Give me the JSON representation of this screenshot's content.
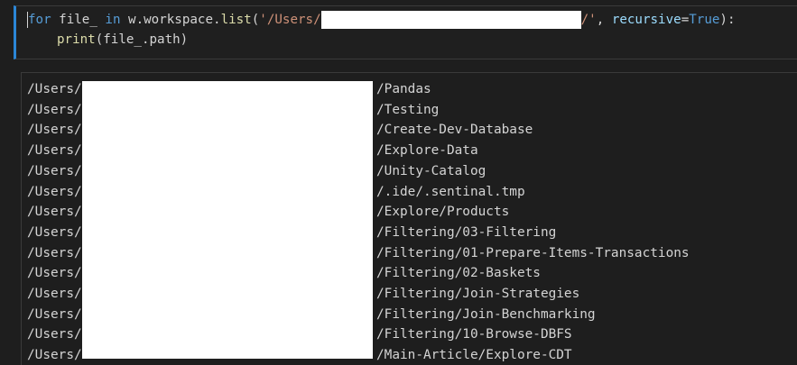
{
  "code": {
    "line1": {
      "kw_for": "for",
      "var": " file_ ",
      "kw_in": "in",
      "obj": " w.workspace.",
      "fn_list": "list",
      "open": "(",
      "str_start": "'/Users/",
      "str_end": "/'",
      "comma": ", ",
      "param": "recursive",
      "eq": "=",
      "true_val": "True",
      "close": "):"
    },
    "line2": {
      "fn_print": "print",
      "args": "(file_.path)"
    }
  },
  "output": {
    "prefix": "/Users/",
    "paths": [
      "/Pandas",
      "/Testing",
      "/Create-Dev-Database",
      "/Explore-Data",
      "/Unity-Catalog",
      "/.ide/.sentinal.tmp",
      "/Explore/Products",
      "/Filtering/03-Filtering",
      "/Filtering/01-Prepare-Items-Transactions",
      "/Filtering/02-Baskets",
      "/Filtering/Join-Strategies",
      "/Filtering/Join-Benchmarking",
      "/Filtering/10-Browse-DBFS",
      "/Main-Article/Explore-CDT"
    ]
  }
}
